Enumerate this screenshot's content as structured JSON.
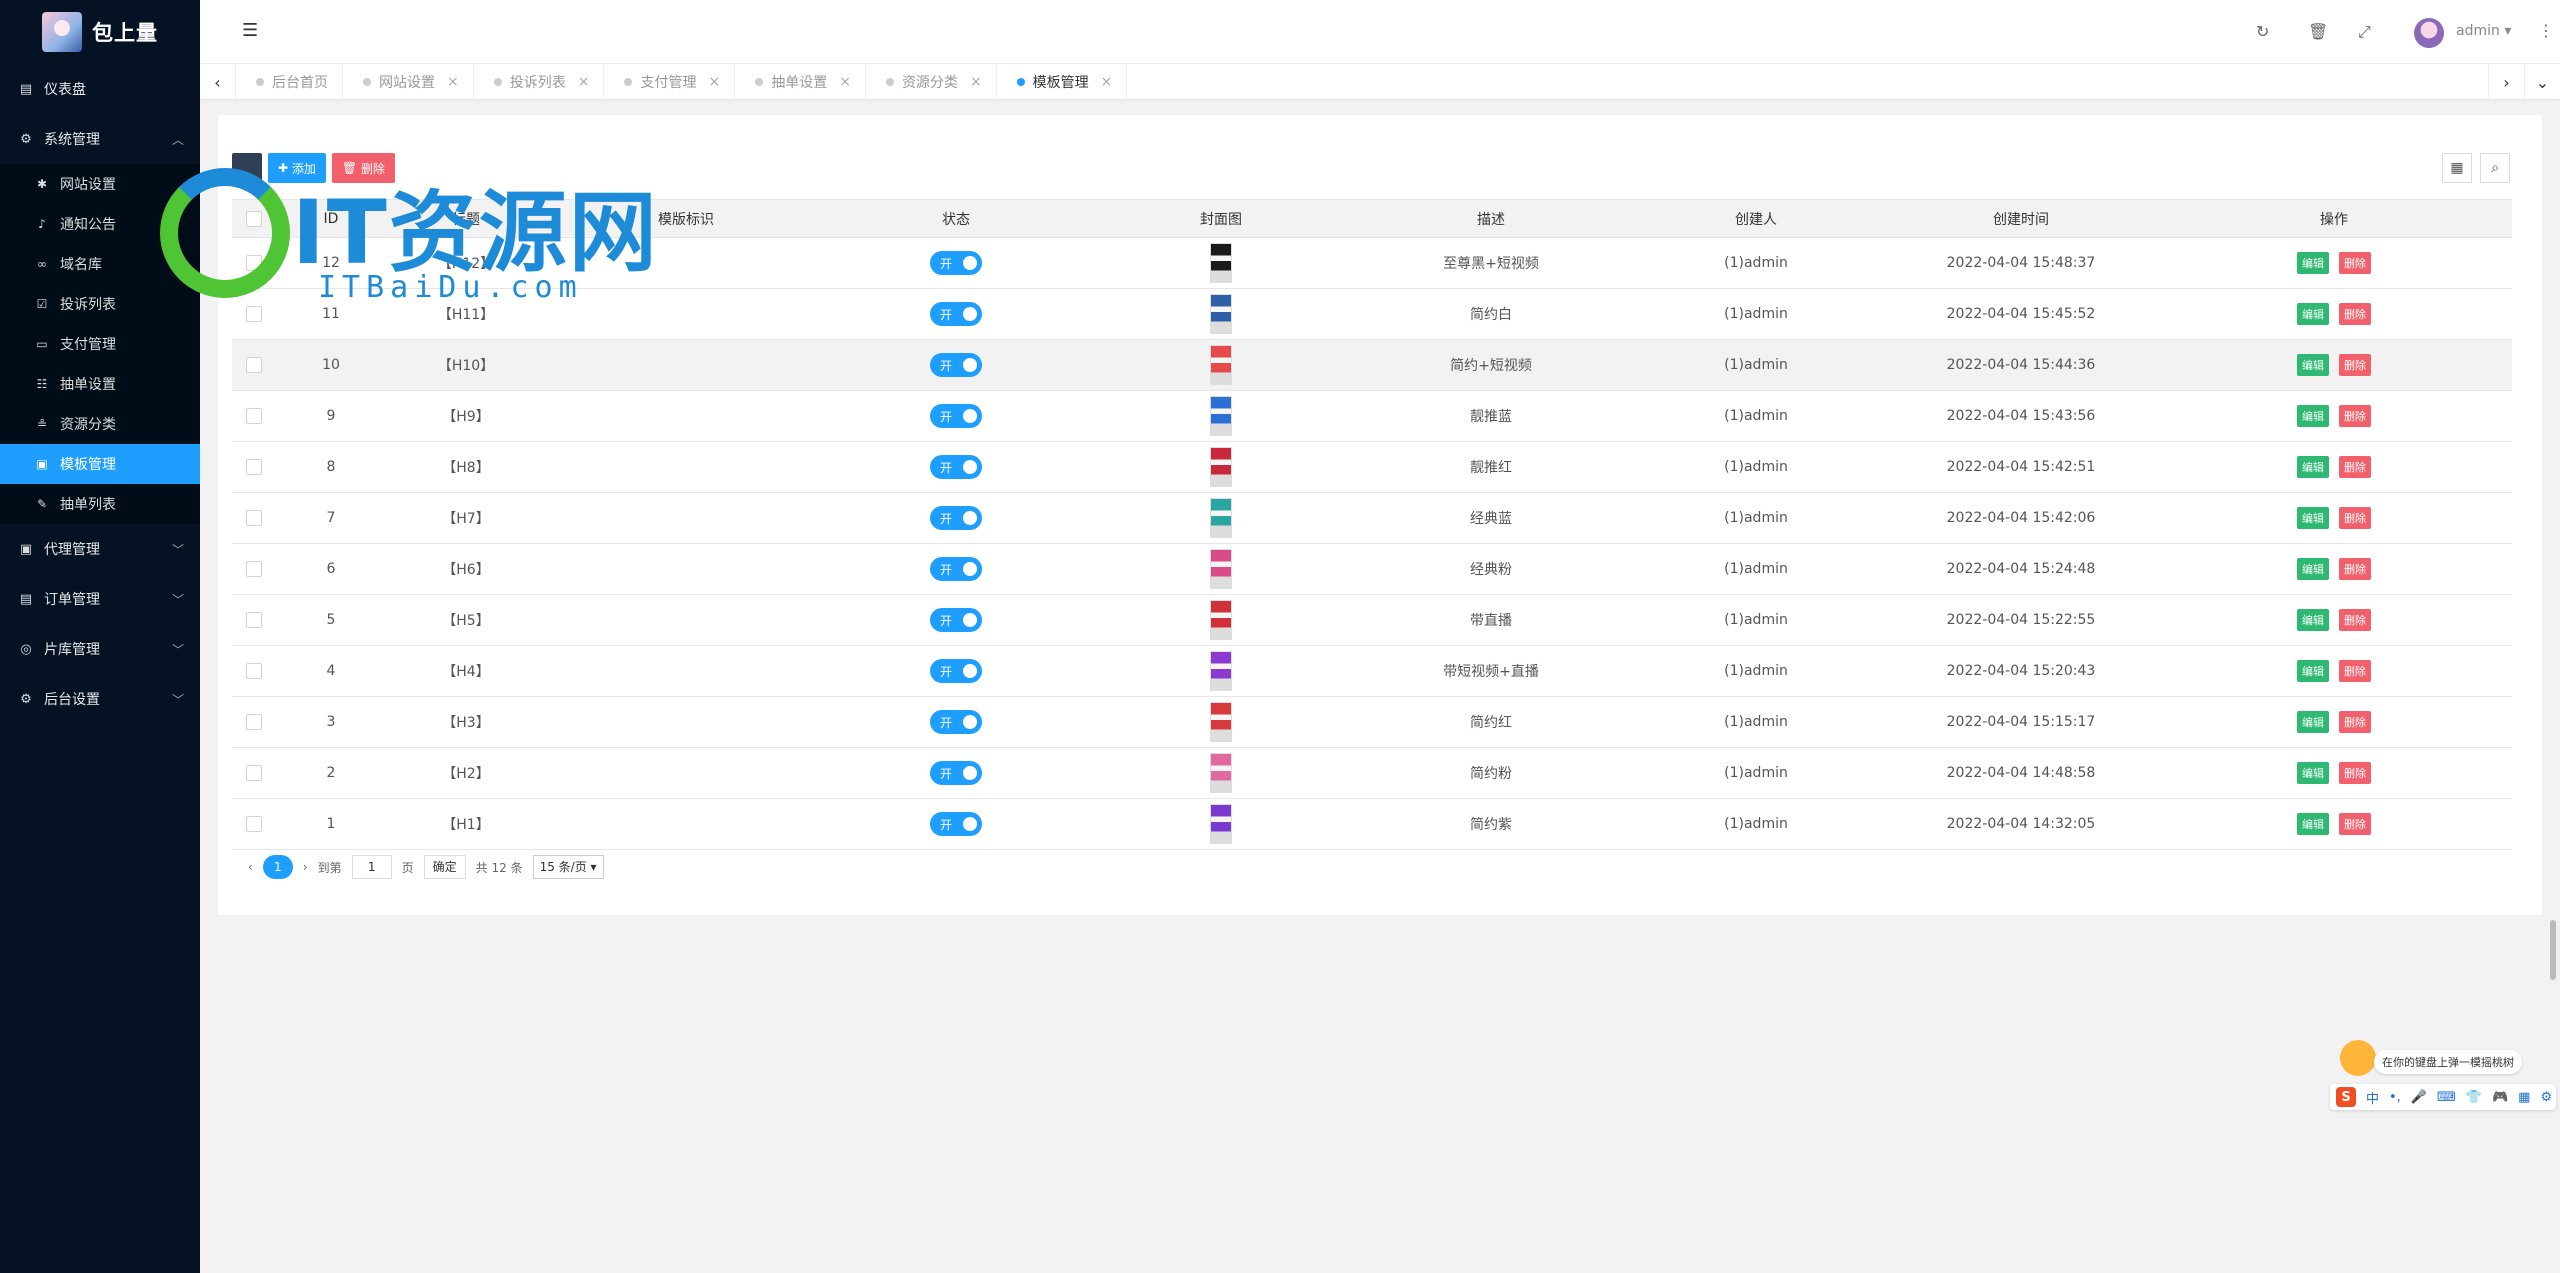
{
  "sidebar": {
    "logo_text": "包上量",
    "items": [
      {
        "label": "仪表盘",
        "icon": "dashboard-icon"
      },
      {
        "label": "系统管理",
        "icon": "settings-icon",
        "expanded": true
      },
      {
        "label": "代理管理",
        "icon": "agent-icon"
      },
      {
        "label": "订单管理",
        "icon": "order-icon"
      },
      {
        "label": "片库管理",
        "icon": "library-icon"
      },
      {
        "label": "后台设置",
        "icon": "gears-icon"
      }
    ],
    "sub_items": [
      {
        "label": "网站设置",
        "icon": "asterisk-icon"
      },
      {
        "label": "通知公告",
        "icon": "bell-icon"
      },
      {
        "label": "域名库",
        "icon": "link-icon"
      },
      {
        "label": "投诉列表",
        "icon": "check-square-icon"
      },
      {
        "label": "支付管理",
        "icon": "card-icon"
      },
      {
        "label": "抽单设置",
        "icon": "bank-icon"
      },
      {
        "label": "资源分类",
        "icon": "layers-icon"
      },
      {
        "label": "模板管理",
        "icon": "template-icon",
        "active": true
      },
      {
        "label": "抽单列表",
        "icon": "brush-icon"
      }
    ]
  },
  "header": {
    "user": "admin"
  },
  "tabs": [
    {
      "label": "后台首页",
      "closable": false
    },
    {
      "label": "网站设置",
      "closable": true
    },
    {
      "label": "投诉列表",
      "closable": true
    },
    {
      "label": "支付管理",
      "closable": true
    },
    {
      "label": "抽单设置",
      "closable": true
    },
    {
      "label": "资源分类",
      "closable": true
    },
    {
      "label": "模板管理",
      "closable": true,
      "active": true
    }
  ],
  "toolbar": {
    "add_label": "添加",
    "delete_label": "删除"
  },
  "table": {
    "columns": [
      "ID",
      "标题",
      "模版标识",
      "状态",
      "封面图",
      "描述",
      "创建人",
      "创建时间",
      "操作"
    ],
    "switch_label": "开",
    "edit_label": "编辑",
    "del_label": "删除",
    "rows": [
      {
        "id": "12",
        "title": "【H12】",
        "desc": "至尊黑+短视频",
        "creator": "(1)admin",
        "time": "2022-04-04 15:48:37",
        "thumb": "#1a1a1a"
      },
      {
        "id": "11",
        "title": "【H11】",
        "desc": "简约白",
        "creator": "(1)admin",
        "time": "2022-04-04 15:45:52",
        "thumb": "#2d5fa8"
      },
      {
        "id": "10",
        "title": "【H10】",
        "desc": "简约+短视频",
        "creator": "(1)admin",
        "time": "2022-04-04 15:44:36",
        "thumb": "#e64a4a"
      },
      {
        "id": "9",
        "title": "【H9】",
        "desc": "靓推蓝",
        "creator": "(1)admin",
        "time": "2022-04-04 15:43:56",
        "thumb": "#2b6fd6"
      },
      {
        "id": "8",
        "title": "【H8】",
        "desc": "靓推红",
        "creator": "(1)admin",
        "time": "2022-04-04 15:42:51",
        "thumb": "#c8283a"
      },
      {
        "id": "7",
        "title": "【H7】",
        "desc": "经典蓝",
        "creator": "(1)admin",
        "time": "2022-04-04 15:42:06",
        "thumb": "#2aa6a0"
      },
      {
        "id": "6",
        "title": "【H6】",
        "desc": "经典粉",
        "creator": "(1)admin",
        "time": "2022-04-04 15:24:48",
        "thumb": "#d84a8a"
      },
      {
        "id": "5",
        "title": "【H5】",
        "desc": "带直播",
        "creator": "(1)admin",
        "time": "2022-04-04 15:22:55",
        "thumb": "#d0303a"
      },
      {
        "id": "4",
        "title": "【H4】",
        "desc": "带短视频+直播",
        "creator": "(1)admin",
        "time": "2022-04-04 15:20:43",
        "thumb": "#8a3ad0"
      },
      {
        "id": "3",
        "title": "【H3】",
        "desc": "简约红",
        "creator": "(1)admin",
        "time": "2022-04-04 15:15:17",
        "thumb": "#d63a3a"
      },
      {
        "id": "2",
        "title": "【H2】",
        "desc": "简约粉",
        "creator": "(1)admin",
        "time": "2022-04-04 14:48:58",
        "thumb": "#e06aa0"
      },
      {
        "id": "1",
        "title": "【H1】",
        "desc": "简约紫",
        "creator": "(1)admin",
        "time": "2022-04-04 14:32:05",
        "thumb": "#7a3ad0"
      }
    ]
  },
  "pager": {
    "current": "1",
    "goto_label": "到第",
    "page_value": "1",
    "page_unit": "页",
    "confirm": "确定",
    "total": "共 12 条",
    "page_size": "15 条/页"
  },
  "watermark": {
    "main": "IT资源网",
    "sub": "ITBaiDu.com"
  },
  "ime": {
    "tip": "在你的键盘上弹一模摇桃树",
    "lang": "中"
  },
  "colors": {
    "accent": "#1e9fff",
    "sidebar_bg": "#041224",
    "edit_btn": "#2eb872",
    "delete_btn": "#f2616b"
  }
}
